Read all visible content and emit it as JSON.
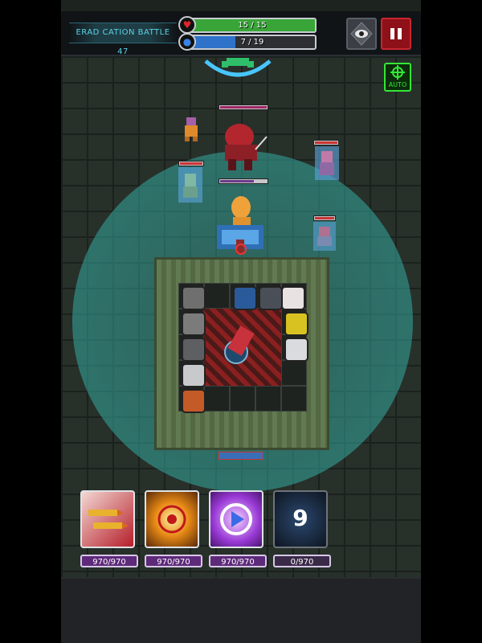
{
  "hud": {
    "stage_label": "ERAD CATION BATTLE 47",
    "hp": {
      "text": "15 / 15",
      "current": 15,
      "max": 15,
      "icon": "heart-icon",
      "color": "#39a538"
    },
    "mp": {
      "text": "7 / 19",
      "current": 7,
      "max": 19,
      "icon": "shield-icon",
      "color": "#2e73c9"
    },
    "view_button_icon": "eye-icon",
    "pause_button_icon": "pause-icon"
  },
  "field": {
    "auto_label": "AUTO",
    "aura_color": "#3cb4aa"
  },
  "skills": [
    {
      "icon": "bullet-burst-icon",
      "count": "970/970"
    },
    {
      "icon": "target-explosion-icon",
      "count": "970/970"
    },
    {
      "icon": "purple-arrow-icon",
      "count": "970/970"
    },
    {
      "icon": "vortex-icon",
      "count": "0/970",
      "cooldown": "9"
    }
  ]
}
